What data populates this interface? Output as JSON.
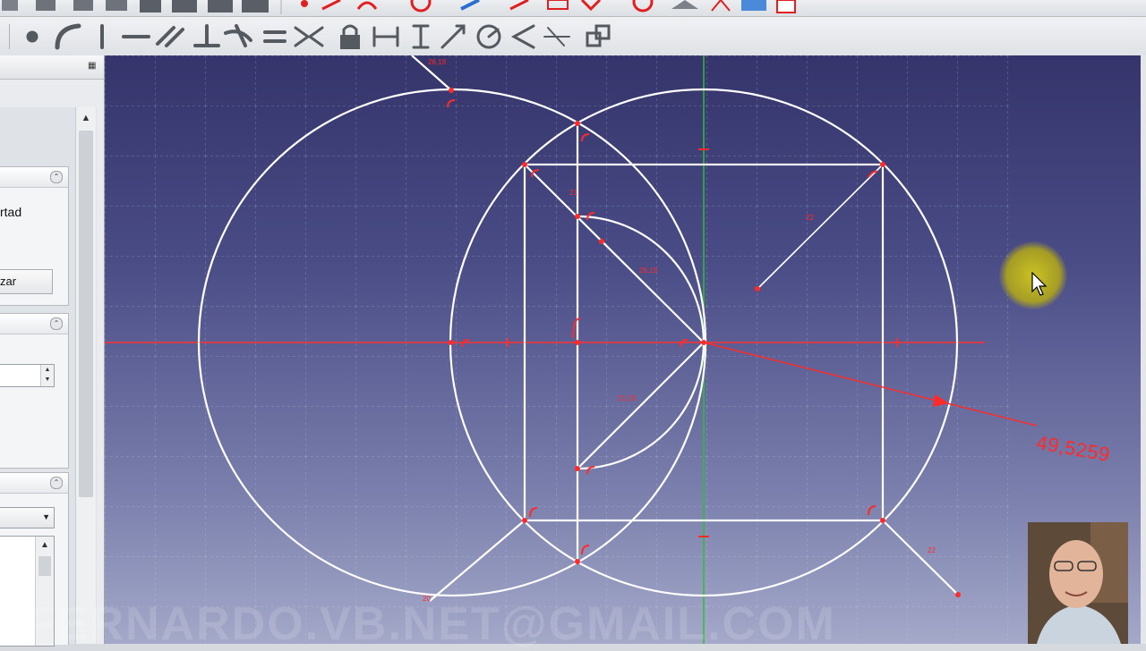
{
  "left_panel": {
    "task1": {
      "text": "rtad",
      "button": "zar"
    }
  },
  "sketch": {
    "dimension_value": "49,5259",
    "constraint_labels": [
      "26,19",
      "26,19",
      "21,20",
      "20",
      "21",
      "22",
      "22"
    ]
  },
  "watermark": "FERNARDO.VB.NET@GMAIL.COM",
  "icons": {
    "constraint_toolbar": [
      "point-coincident-icon",
      "point-on-object-icon",
      "vertical-icon",
      "horizontal-icon",
      "parallel-icon",
      "perpendicular-icon",
      "tangent-icon",
      "equal-icon",
      "symmetric-icon",
      "lock-icon",
      "horizontal-distance-icon",
      "vertical-distance-icon",
      "distance-icon",
      "radius-icon",
      "angle-icon",
      "snell-law-icon",
      "toggle-construction-icon"
    ]
  },
  "colors": {
    "geometry": "#ffffff",
    "constraint": "#ff2a2a",
    "y_axis": "#2fbf2f",
    "x_axis": "#ff3030",
    "cursor_highlight": "#c8c01e"
  }
}
